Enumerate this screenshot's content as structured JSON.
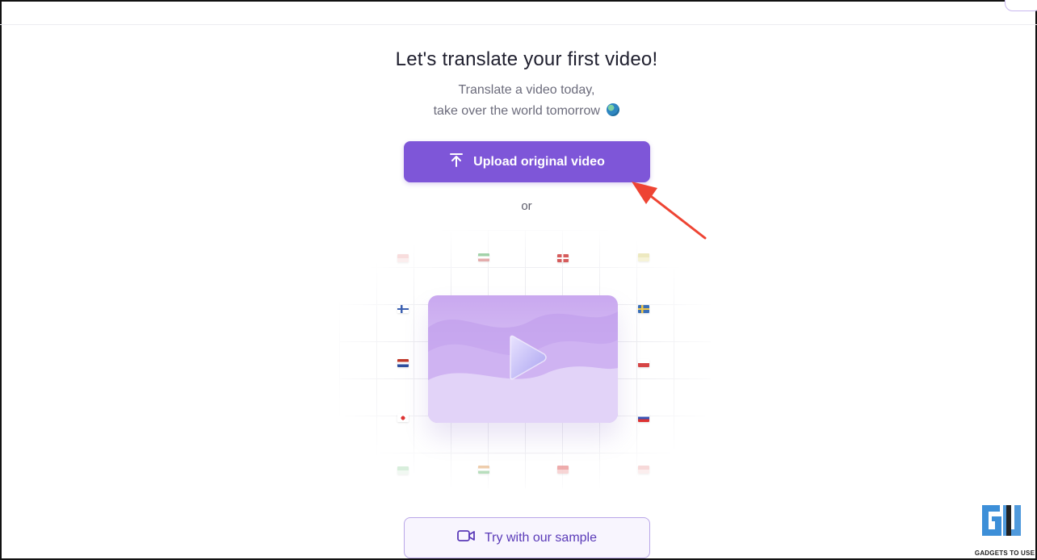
{
  "heading": "Let's translate your first video!",
  "subtitle_line1": "Translate a video today,",
  "subtitle_line2": "take over the world tomorrow",
  "upload_button": {
    "label": "Upload original video",
    "icon": "upload-arrow-icon"
  },
  "divider_text": "or",
  "sample_button": {
    "label": "Try with our sample",
    "icon": "video-camera-icon"
  },
  "watermark_text": "GADGETS TO USE",
  "colors": {
    "accent": "#7e56d8",
    "annotation_arrow": "#ee4433",
    "sample_border": "#b9a6e8"
  }
}
